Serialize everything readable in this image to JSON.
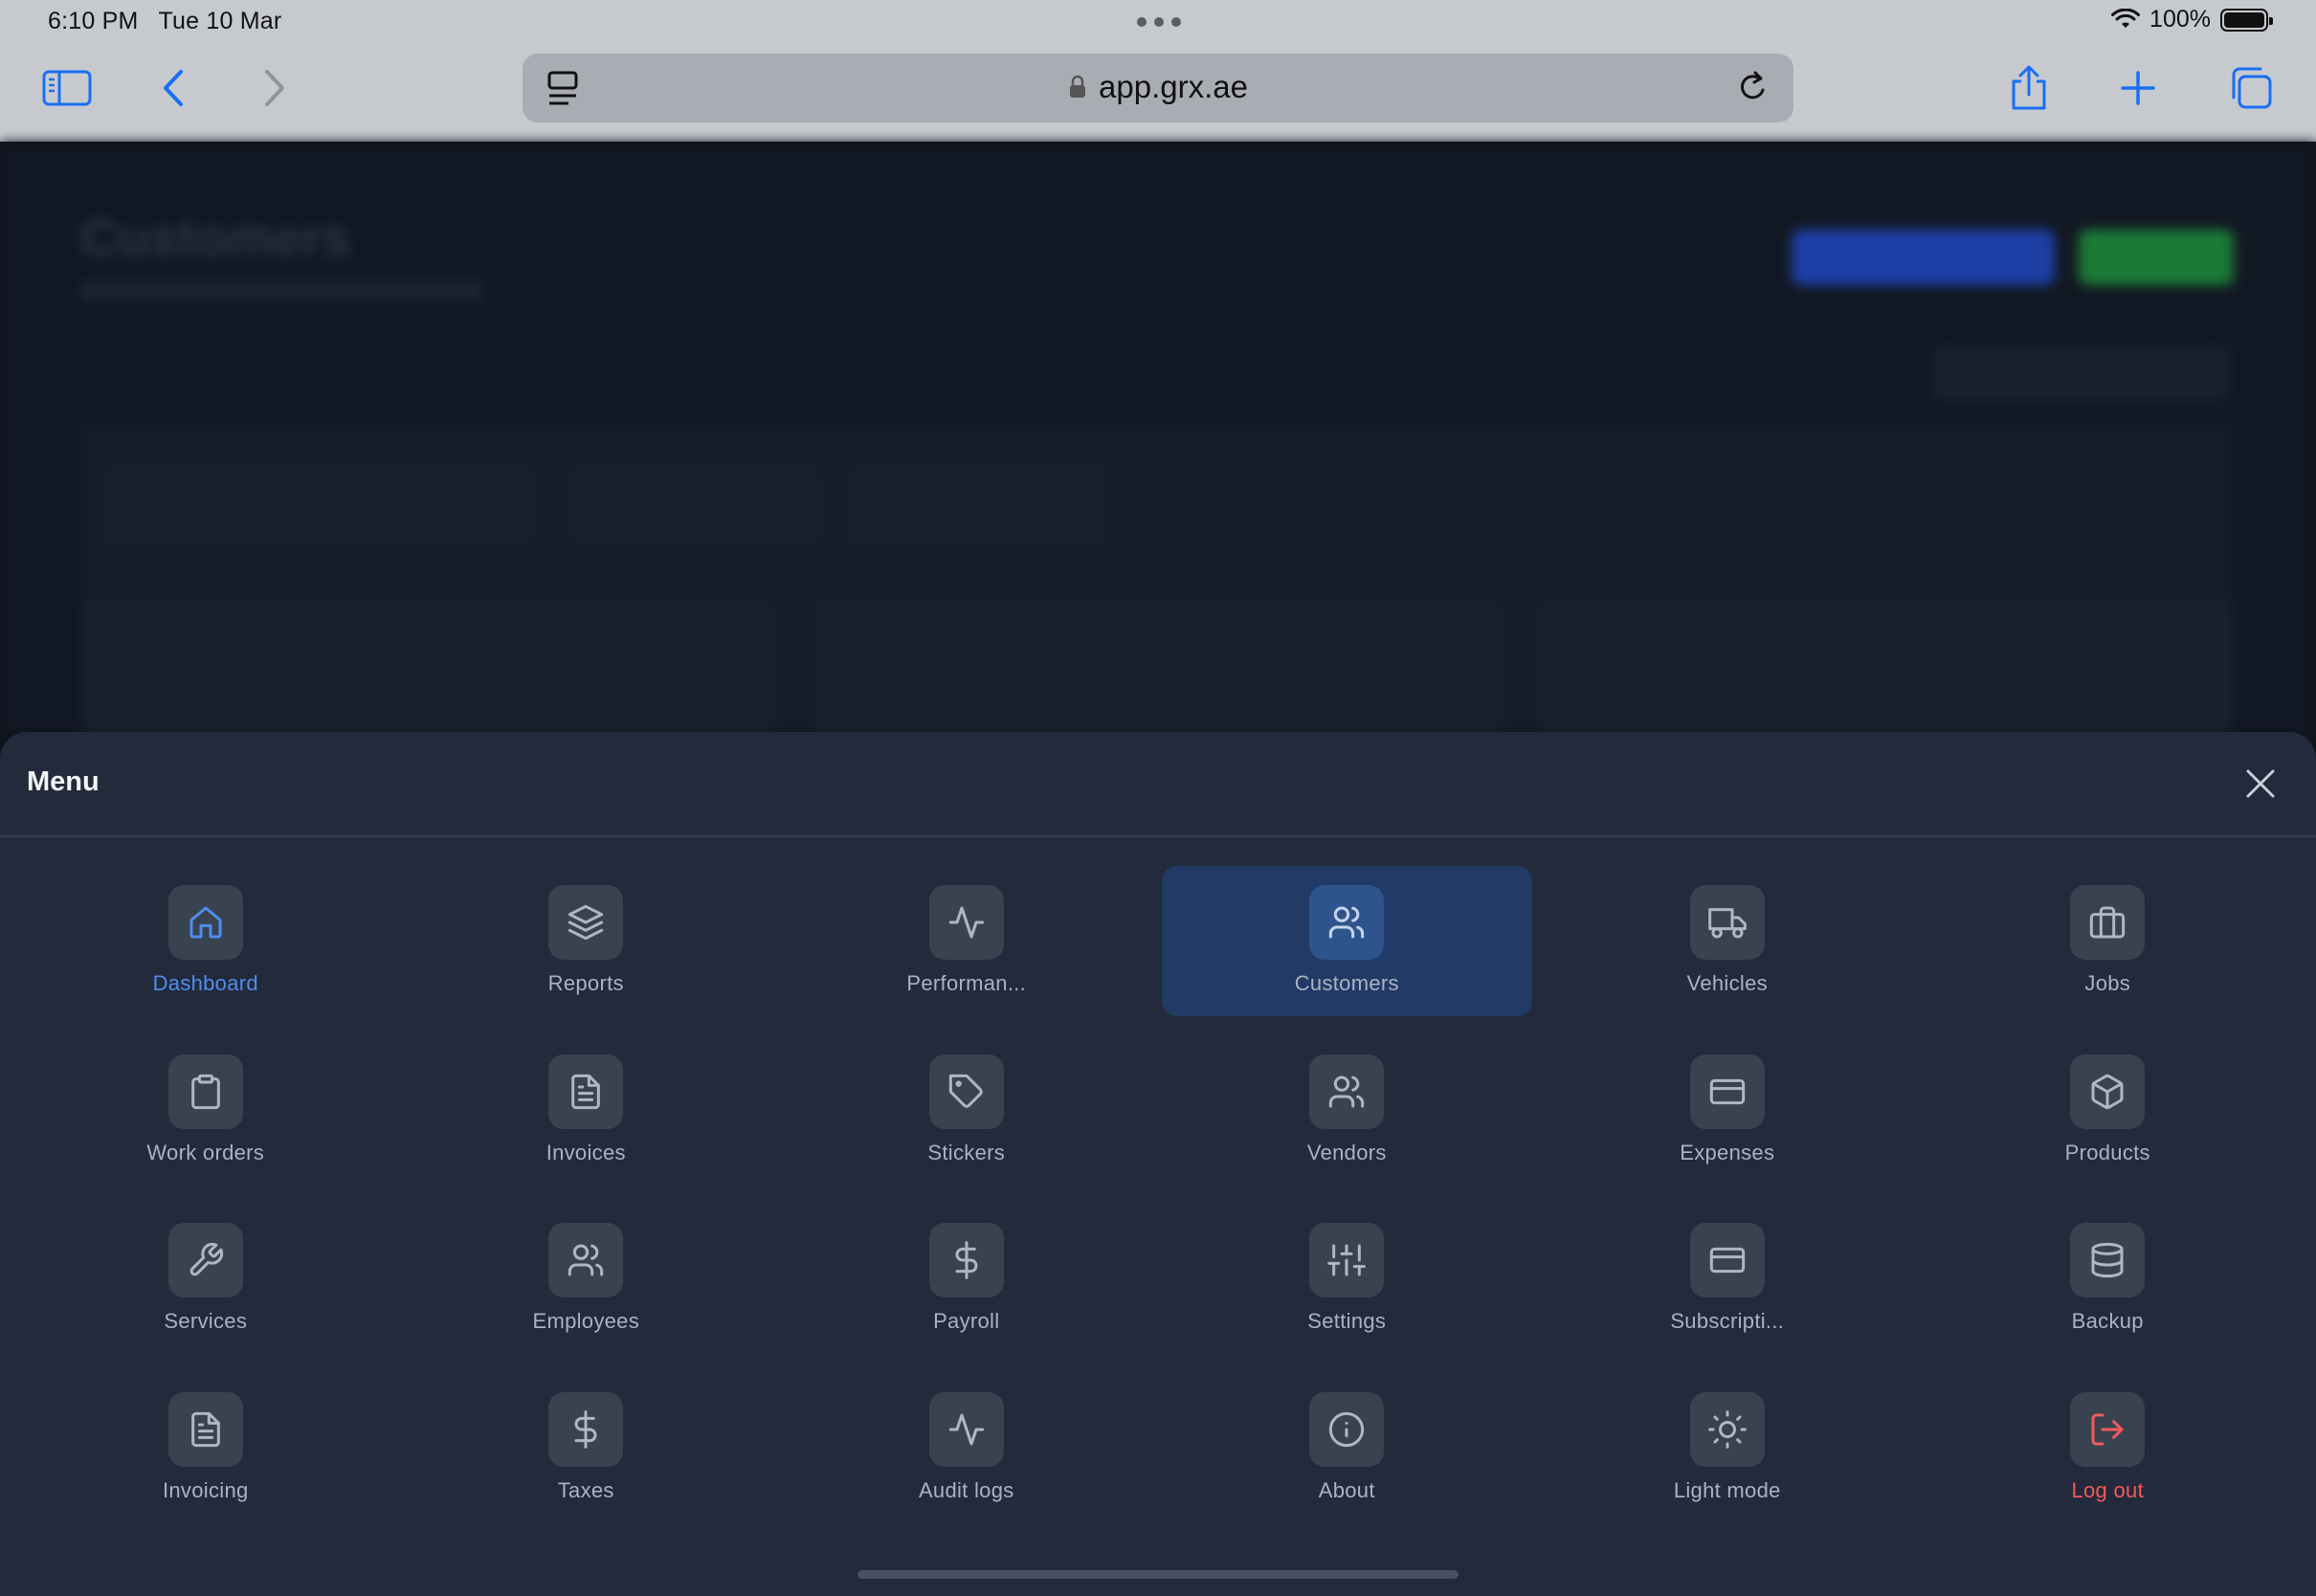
{
  "status": {
    "time": "6:10 PM",
    "date": "Tue 10 Mar",
    "battery": "100%"
  },
  "browser": {
    "url": "app.grx.ae"
  },
  "background_page": {
    "title": "Customers"
  },
  "menu": {
    "title": "Menu",
    "items": [
      {
        "label": "Dashboard",
        "icon": "home-icon"
      },
      {
        "label": "Reports",
        "icon": "layers-icon"
      },
      {
        "label": "Performan...",
        "icon": "activity-icon"
      },
      {
        "label": "Customers",
        "icon": "users-icon"
      },
      {
        "label": "Vehicles",
        "icon": "truck-icon"
      },
      {
        "label": "Jobs",
        "icon": "briefcase-icon"
      },
      {
        "label": "Work orders",
        "icon": "clipboard-icon"
      },
      {
        "label": "Invoices",
        "icon": "file-text-icon"
      },
      {
        "label": "Stickers",
        "icon": "tag-icon"
      },
      {
        "label": "Vendors",
        "icon": "users-icon"
      },
      {
        "label": "Expenses",
        "icon": "credit-card-icon"
      },
      {
        "label": "Products",
        "icon": "box-icon"
      },
      {
        "label": "Services",
        "icon": "wrench-icon"
      },
      {
        "label": "Employees",
        "icon": "users-icon"
      },
      {
        "label": "Payroll",
        "icon": "dollar-icon"
      },
      {
        "label": "Settings",
        "icon": "sliders-icon"
      },
      {
        "label": "Subscripti...",
        "icon": "credit-card-icon"
      },
      {
        "label": "Backup",
        "icon": "database-icon"
      },
      {
        "label": "Invoicing",
        "icon": "file-text-icon"
      },
      {
        "label": "Taxes",
        "icon": "dollar-icon"
      },
      {
        "label": "Audit logs",
        "icon": "activity-icon"
      },
      {
        "label": "About",
        "icon": "info-icon"
      },
      {
        "label": "Light mode",
        "icon": "sun-icon"
      },
      {
        "label": "Log out",
        "icon": "log-out-icon"
      }
    ]
  },
  "colors": {
    "accent": "#4f8df0",
    "danger": "#f25b5b",
    "sheet": "#232a3b",
    "active_tile": "#213a66"
  }
}
